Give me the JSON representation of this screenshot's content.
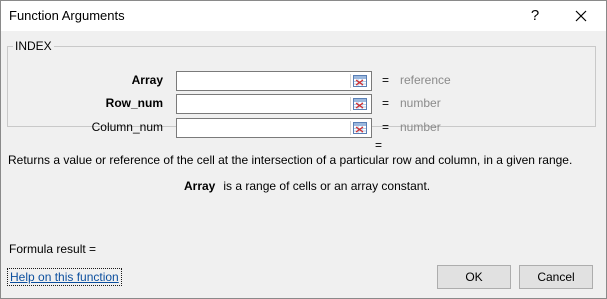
{
  "titlebar": {
    "title": "Function Arguments",
    "help_glyph": "?",
    "close_icon": "close-icon"
  },
  "group": {
    "legend": "INDEX",
    "args": [
      {
        "label": "Array",
        "value": "",
        "eq": "=",
        "hint": "reference",
        "bold": true
      },
      {
        "label": "Row_num",
        "value": "",
        "eq": "=",
        "hint": "number",
        "bold": true
      },
      {
        "label": "Column_num",
        "value": "",
        "eq": "=",
        "hint": "number",
        "bold": false
      }
    ],
    "ref_icon": "range-select-icon"
  },
  "result_eq": "=",
  "description": "Returns a value or reference of the cell at the intersection of a particular row and column, in a given range.",
  "arg_help": {
    "name": "Array",
    "text": "is a range of cells or an array constant."
  },
  "formula_result": "Formula result =",
  "footer": {
    "help_link": "Help on this function",
    "ok": "OK",
    "cancel": "Cancel"
  },
  "colors": {
    "hint_text": "#8a8a8a",
    "link": "#0c4f9e",
    "dialog_bg": "#f0f0f0"
  }
}
